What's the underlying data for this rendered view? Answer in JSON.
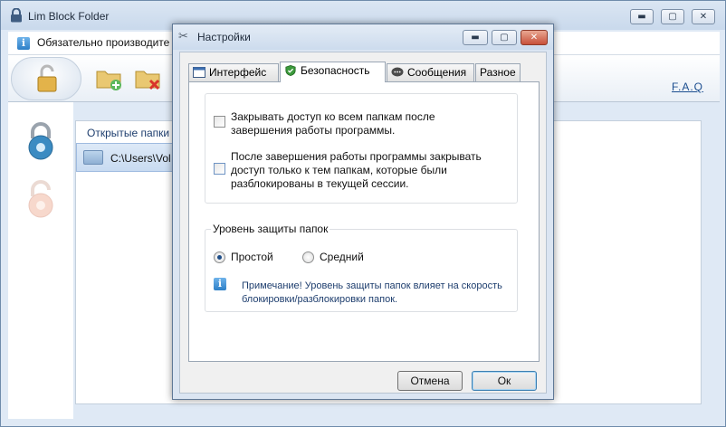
{
  "main": {
    "title": "Lim Block Folder",
    "notice": "Обязательно производите ра",
    "faq_label": "F.A.Q",
    "list_header": "Открытые папки",
    "list_row_path": "C:\\Users\\Vol",
    "controls": {
      "minimize": "▬",
      "maximize": "▢",
      "close": "✕"
    }
  },
  "dialog": {
    "title": "Настройки",
    "controls": {
      "minimize": "▬",
      "maximize": "▢",
      "close": "✕"
    },
    "tabs": [
      {
        "label": "Интерфейс",
        "icon": "window-icon"
      },
      {
        "label": "Безопасность",
        "icon": "shield-icon"
      },
      {
        "label": "Сообщения",
        "icon": "speech-bubble-icon"
      },
      {
        "label": "Разное",
        "icon": ""
      }
    ],
    "active_tab": "Безопасность",
    "security": {
      "checkbox1": {
        "line1": "Закрывать доступ ко всем папкам после",
        "line2": "завершения работы программы.",
        "checked": false
      },
      "checkbox2": {
        "line1": "После завершения работы программы закрывать",
        "line2": "доступ только к тем папкам, которые были",
        "line3": "разблокированы в текущей сессии.",
        "checked": false
      },
      "protection_group_label": "Уровень защиты папок",
      "radio_simple": {
        "label": "Простой",
        "checked": true
      },
      "radio_medium": {
        "label": "Средний",
        "checked": false
      },
      "note_line1": "Примечание! Уровень защиты папок влияет на скорость",
      "note_line2": "блокировки/разблокировки папок."
    },
    "cancel_label": "Отмена",
    "ok_label": "Ок"
  },
  "colors": {
    "accent": "#1f4e88",
    "window_frame": "#dbe5f2",
    "close_button": "#c7503a"
  }
}
